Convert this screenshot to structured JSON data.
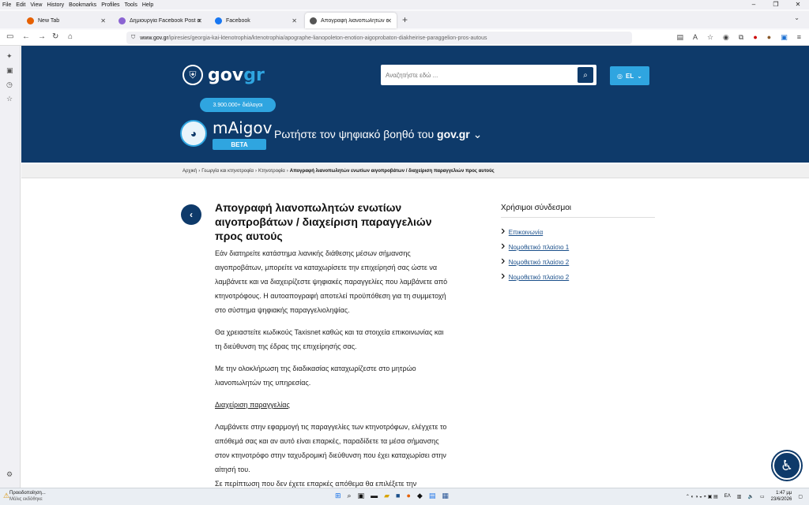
{
  "menu": [
    "File",
    "Edit",
    "View",
    "History",
    "Bookmarks",
    "Profiles",
    "Tools",
    "Help"
  ],
  "window_controls": [
    "–",
    "❐",
    "✕"
  ],
  "tabs": [
    {
      "label": "New Tab",
      "color": "#e66000"
    },
    {
      "label": "Δημιουργία Facebook Post απ",
      "color": "#8a63d2"
    },
    {
      "label": "Facebook",
      "color": "#1877f2"
    },
    {
      "label": "Απογραφή λιανοπωλητών εν",
      "color": "#555"
    }
  ],
  "url": {
    "domain": "www.gov.gr",
    "path": "/ipiresies/georgia-kai-ktenotrophia/ktenotrophia/apographe-lianopoleton-enotion-aigoprobaton-diakheirise-paraggelion-pros-autous"
  },
  "header": {
    "logo_gov": "gov",
    "logo_gr": "gr",
    "search_placeholder": "Αναζητήστε εδώ ...",
    "lang": "EL",
    "dialogues": "3.900.000+ διάλογοι",
    "maigov": "mAigov",
    "beta": "BETA",
    "ask_text": "Ρωτήστε τον ψηφιακό βοηθό του",
    "ask_bold": "gov.gr"
  },
  "breadcrumbs": [
    "Αρχική",
    "Γεωργία και κτηνοτροφία",
    "Κτηνοτροφία"
  ],
  "breadcrumb_current": "Απογραφή λιανοπωλητών ενωτίων αιγοπροβάτων / διαχείριση παραγγελιών προς αυτούς",
  "article": {
    "title": "Απογραφή λιανοπωλητών ενωτίων αιγοπροβάτων / διαχείριση παραγγελιών προς αυτούς",
    "p1": "Εάν διατηρείτε κατάστημα λιανικής διάθεσης μέσων σήμανσης αιγοπροβάτων, μπορείτε να καταχωρίσετε την επιχείρησή σας ώστε να λαμβάνετε και να διαχειρίζεστε ψηφιακές παραγγελίες που λαμβάνετε από κτηνοτρόφους. Η αυτοαπογραφή αποτελεί προϋπόθεση για τη συμμετοχή στο σύστημα ψηφιακής παραγγελιοληψίας.",
    "p2": "Θα χρειαστείτε κωδικούς Taxisnet καθώς και τα στοιχεία επικοινωνίας και τη διεύθυνση της έδρας της επιχείρησής σας.",
    "p3": "Με την ολοκλήρωση της διαδικασίας καταχωρίζεστε στο μητρώο λιανοπωλητών της υπηρεσίας.",
    "subheading": "Διαχείριση παραγγελίας",
    "p4": "Λαμβάνετε στην εφαρμογή τις παραγγελίες των κτηνοτρόφων, ελέγχετε το απόθεμά σας και αν αυτό είναι επαρκές, παραδίδετε τα μέσα σήμανσης στον κτηνοτρόφο στην ταχυδρομική διεύθυνση που έχει καταχωρίσει στην αίτησή του.",
    "p5": "Σε περίπτωση που δεν έχετε επαρκές απόθεμα θα επιλέξετε την"
  },
  "useful_links": {
    "heading": "Χρήσιμοι σύνδεσμοι",
    "items": [
      "Επικοινωνία",
      "Νομοθετικό πλαίσιο 1",
      "Νομοθετικό πλαίσιο 2",
      "Νομοθετικό πλαίσιο 2"
    ]
  },
  "taskbar": {
    "notif_title": "Προειδοποίηση...",
    "notif_sub": "Μόλις εκδόθηκε",
    "lang": "ΕΛ",
    "time": "1:47 μμ",
    "date": "23/6/2026"
  }
}
